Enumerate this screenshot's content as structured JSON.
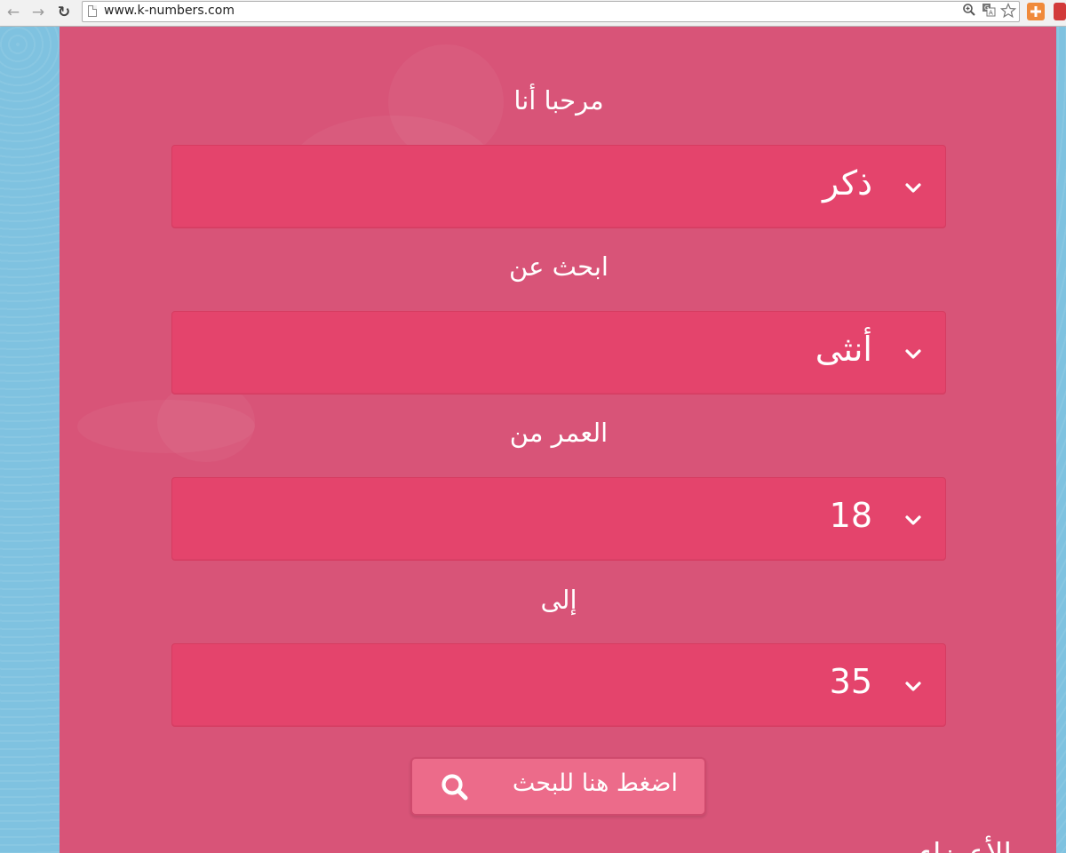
{
  "browser": {
    "url": "www.k-numbers.com",
    "back_glyph": "←",
    "forward_glyph": "→",
    "reload_glyph": "↻",
    "icons": [
      "zoom-icon",
      "translate-icon",
      "bookmark-star-icon",
      "add-extension-icon",
      "extension-icon"
    ]
  },
  "form": {
    "i_am": {
      "label": "مرحبا أنا",
      "value": "ذكر"
    },
    "looking_for": {
      "label": "ابحث عن",
      "value": "أنثى"
    },
    "age_from": {
      "label": "العمر من",
      "value": "18"
    },
    "age_to": {
      "label": "إلى",
      "value": "35"
    },
    "search_button": "اضغط هنا للبحث"
  },
  "footer": {
    "heading_partial": "الأعضاء"
  },
  "colors": {
    "panel": "#d85478",
    "select": "#e4446c",
    "button": "#ec6b8a",
    "side": "#7fc2e0"
  }
}
